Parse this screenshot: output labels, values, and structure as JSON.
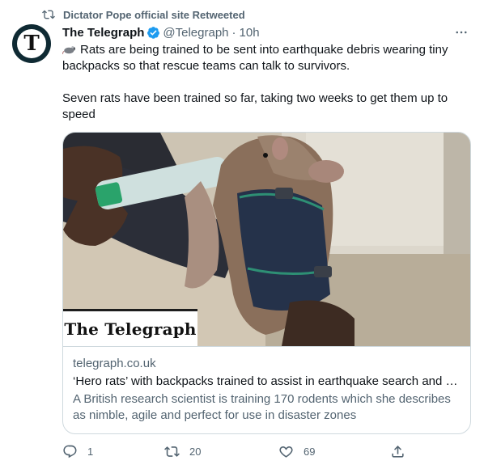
{
  "retweet": {
    "label": "Dictator Pope official site Retweeted"
  },
  "author": {
    "name": "The Telegraph",
    "handle": "@Telegraph",
    "separator": "·",
    "time": "10h",
    "avatar_glyph": "T"
  },
  "tweet": {
    "line1": "Rats are being trained to be sent into earthquake debris wearing tiny backpacks so that rescue teams can talk to survivors.",
    "line2": "Seven rats have been trained so far, taking two weeks to get them up to speed",
    "emoji_icon": "rat-icon"
  },
  "card": {
    "logo_text": "The Telegraph",
    "domain": "telegraph.co.uk",
    "title": "‘Hero rats’ with backpacks trained to assist in earthquake search and rescue",
    "description": "A British research scientist is training 170 rodents which she describes as nimble, agile and perfect for use in disaster zones"
  },
  "actions": {
    "replies": "1",
    "retweets": "20",
    "likes": "69"
  },
  "colors": {
    "muted": "#536471",
    "text": "#0f1419",
    "verified": "#1d9bf0",
    "border": "#cfd9de"
  }
}
